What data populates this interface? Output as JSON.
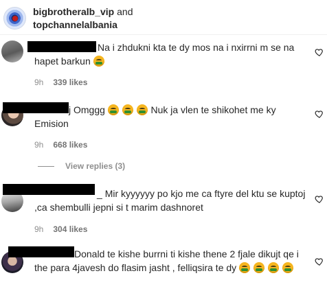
{
  "header": {
    "account_1": "bigbrotheralb_vip",
    "and": "and",
    "account_2": "topchannelalbania"
  },
  "comments": [
    {
      "text": "Na i zhdukni kta te dy mos na i nxirrni m se na hapet barkun",
      "emoji_count": 1,
      "time": "9h",
      "likes": "339 likes"
    },
    {
      "text_prefix": "j Omggg",
      "text": "Nuk ja vlen te shikohet me ky Emision",
      "emoji_count": 3,
      "time": "9h",
      "likes": "668 likes"
    },
    {
      "text_prefix": "_",
      "text": "Mir kyyyyyy po kjo me ca ftyre del ktu se kuptoj ,ca shembulli jepni si t marim dashnoret",
      "time": "9h",
      "likes": "304 likes"
    },
    {
      "text": "Donald te kishe burrni ti kishe thene 2 fjale dikujt qe i the para 4javesh do flasim jasht , felliqsira te dy",
      "emoji_count": 4
    }
  ],
  "view_replies": "View replies (3)",
  "icons": {
    "heart": "heart-icon",
    "profile": "profile-avatar"
  },
  "colors": {
    "text": "#262626",
    "muted": "#8e8e8e",
    "emoji": "#f5b51f"
  }
}
